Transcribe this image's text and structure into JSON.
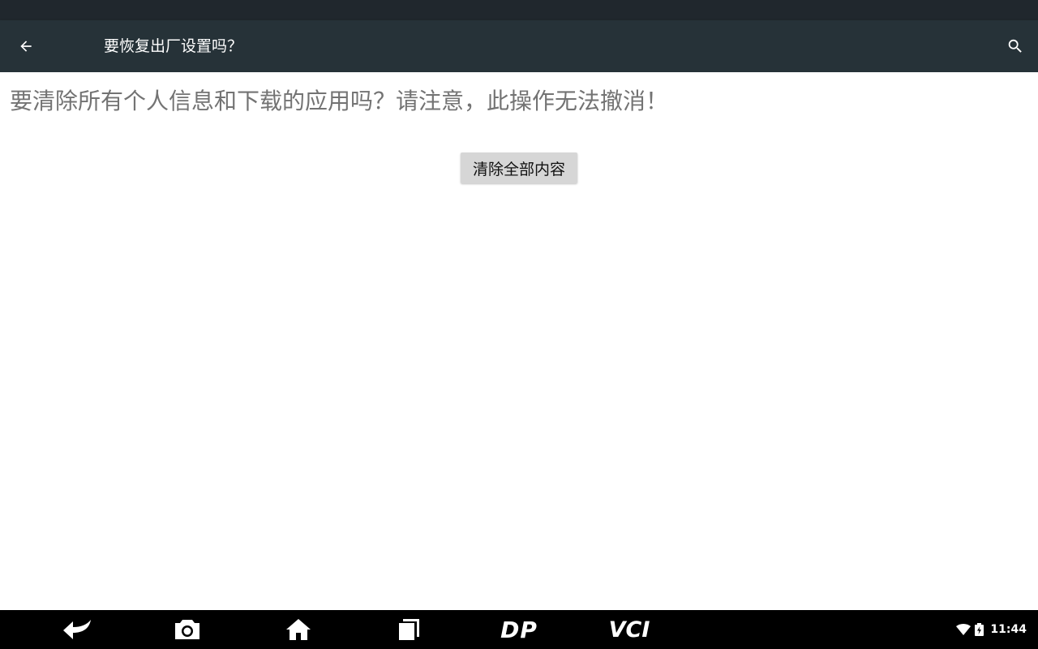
{
  "app_bar": {
    "title": "要恢复出厂设置吗？",
    "back_icon": "arrow-left-icon",
    "search_icon": "search-icon",
    "background": "#263238"
  },
  "content": {
    "message": "要清除所有个人信息和下载的应用吗？请注意，此操作无法撤消！",
    "erase_button_label": "清除全部内容"
  },
  "nav_bar": {
    "buttons": [
      {
        "icon": "back-arrow-icon"
      },
      {
        "icon": "camera-icon"
      },
      {
        "icon": "home-icon"
      },
      {
        "icon": "recent-apps-icon"
      },
      {
        "icon": "dp-logo-icon",
        "label": "DP"
      },
      {
        "icon": "vci-logo-icon",
        "label": "VCI"
      }
    ]
  },
  "status": {
    "time": "11:44",
    "wifi_icon": "wifi-icon",
    "battery_icon": "battery-charging-icon"
  }
}
